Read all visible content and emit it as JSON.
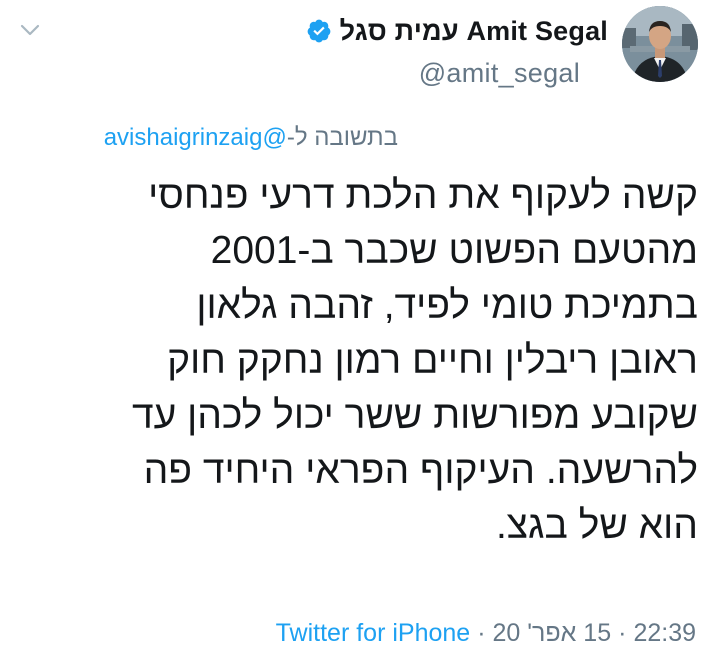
{
  "tweet": {
    "author": {
      "display_name": "Amit Segal עמית סגל",
      "handle": "@amit_segal",
      "verified": true
    },
    "reply_prefix": "בתשובה ל-",
    "reply_to": "@avishaigrinzaig",
    "body_lines": [
      "קשה לעקוף את הלכת דרעי פנחסי",
      "מהטעם הפשוט שכבר ב-2001",
      "בתמיכת טומי לפיד, זהבה גלאון",
      "ראובן ריבלין וחיים רמון נחקק חוק",
      "שקובע מפורשות ששר יכול לכהן עד",
      "להרשעה. העיקוף הפראי היחיד פה",
      "הוא של בגצ."
    ],
    "time": "22:39",
    "date": "15 אפר' 20",
    "separator": "·",
    "source": "Twitter for iPhone"
  },
  "icons": {
    "menu": "chevron-down-icon",
    "verified": "verified-badge-icon",
    "avatar": "profile-photo"
  },
  "colors": {
    "text_primary": "#14171a",
    "text_secondary": "#657786",
    "link": "#1da1f2",
    "verified": "#1da1f2"
  }
}
